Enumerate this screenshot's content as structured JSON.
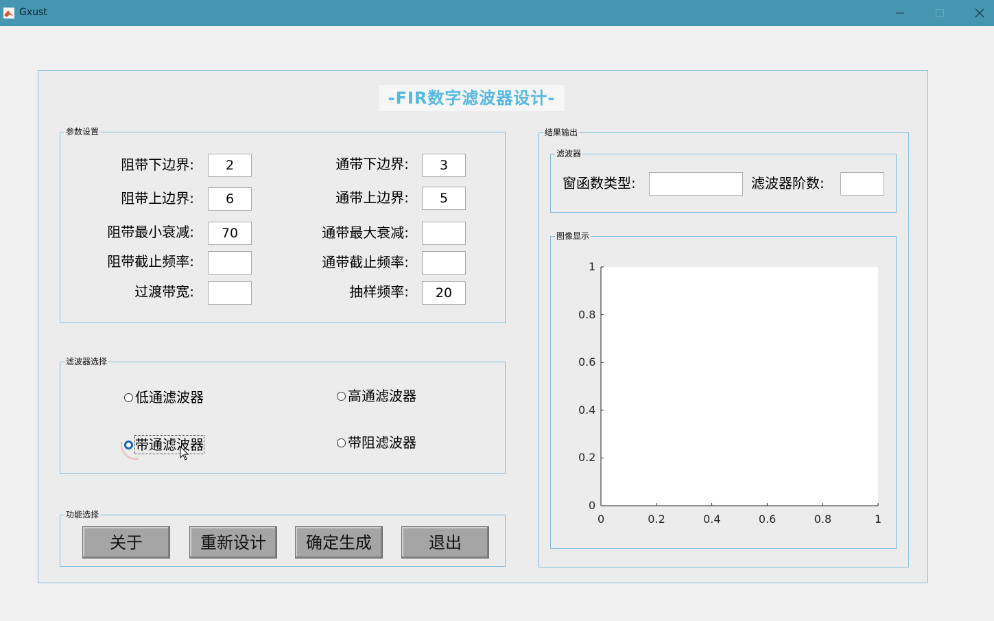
{
  "window": {
    "title": "Gxust"
  },
  "main_title": "-FIR数字滤波器设计-",
  "params": {
    "title": "参数设置",
    "stop_lower_label": "阻带下边界:",
    "stop_lower_value": "2",
    "stop_upper_label": "阻带上边界:",
    "stop_upper_value": "6",
    "stop_min_atten_label": "阻带最小衰减:",
    "stop_min_atten_value": "70",
    "stop_cutoff_label": "阻带截止频率:",
    "stop_cutoff_value": "",
    "transition_label": "过渡带宽:",
    "transition_value": "",
    "pass_lower_label": "通带下边界:",
    "pass_lower_value": "3",
    "pass_upper_label": "通带上边界:",
    "pass_upper_value": "5",
    "pass_max_atten_label": "通带最大衰减:",
    "pass_max_atten_value": "",
    "pass_cutoff_label": "通带截止频率:",
    "pass_cutoff_value": "",
    "sampling_label": "抽样频率:",
    "sampling_value": "20"
  },
  "filter_select": {
    "title": "滤波器选择",
    "lowpass": "低通滤波器",
    "highpass": "高通滤波器",
    "bandpass": "带通滤波器",
    "bandstop": "带阻滤波器",
    "selected": "bandpass"
  },
  "functions": {
    "title": "功能选择",
    "about": "关于",
    "redesign": "重新设计",
    "generate": "确定生成",
    "exit": "退出"
  },
  "results": {
    "title": "结果输出",
    "filter_group_title": "滤波器",
    "window_type_label": "窗函数类型:",
    "window_type_value": "",
    "order_label": "滤波器阶数:",
    "order_value": "",
    "image_group_title": "图像显示"
  },
  "axes": {
    "xlim": [
      0,
      1
    ],
    "ylim": [
      0,
      1
    ],
    "xticks": [
      "0",
      "0.2",
      "0.4",
      "0.6",
      "0.8",
      "1"
    ],
    "yticks": [
      "0",
      "0.2",
      "0.4",
      "0.6",
      "0.8",
      "1"
    ]
  },
  "colors": {
    "titlebar": "#4596b1",
    "accent": "#55b8df",
    "border": "#7fc0dd",
    "button": "#a5a5a5"
  },
  "icons": {
    "app": "matlab-icon",
    "minimize": "minimize-icon",
    "maximize": "maximize-icon",
    "close": "close-icon"
  }
}
